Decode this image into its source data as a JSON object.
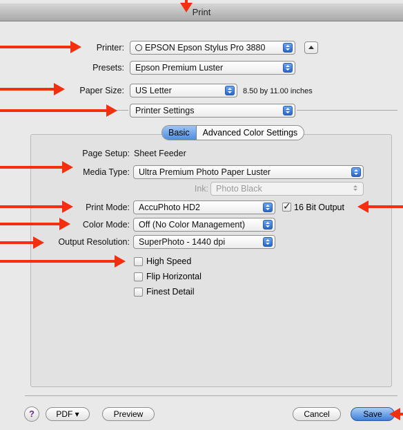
{
  "window": {
    "title": "Print"
  },
  "printer": {
    "label": "Printer:",
    "value": "EPSON Epson Stylus Pro 3880"
  },
  "presets": {
    "label": "Presets:",
    "value": "Epson Premium Luster"
  },
  "paper_size": {
    "label": "Paper Size:",
    "value": "US Letter",
    "dimensions": "8.50 by 11.00 inches"
  },
  "section_popup": {
    "value": "Printer Settings"
  },
  "tabs": [
    {
      "label": "Basic",
      "selected": true
    },
    {
      "label": "Advanced Color Settings",
      "selected": false
    }
  ],
  "page_setup": {
    "label": "Page Setup:",
    "value": "Sheet Feeder"
  },
  "media_type": {
    "label": "Media Type:",
    "value": "Ultra Premium Photo Paper Luster"
  },
  "ink": {
    "label": "Ink:",
    "value": "Photo Black",
    "enabled": false
  },
  "print_mode": {
    "label": "Print Mode:",
    "value": "AccuPhoto HD2"
  },
  "bit_output": {
    "label": "16 Bit Output",
    "checked": true
  },
  "color_mode": {
    "label": "Color Mode:",
    "value": "Off (No Color Management)"
  },
  "output_resolution": {
    "label": "Output Resolution:",
    "value": "SuperPhoto - 1440 dpi"
  },
  "options": [
    {
      "label": "High Speed",
      "checked": false
    },
    {
      "label": "Flip Horizontal",
      "checked": false
    },
    {
      "label": "Finest Detail",
      "checked": false
    }
  ],
  "footer": {
    "help": "?",
    "pdf": "PDF ▾",
    "preview": "Preview",
    "cancel": "Cancel",
    "save": "Save"
  },
  "colors": {
    "annotation_arrow": "#f2300f",
    "accent_blue": "#4f8de0"
  }
}
